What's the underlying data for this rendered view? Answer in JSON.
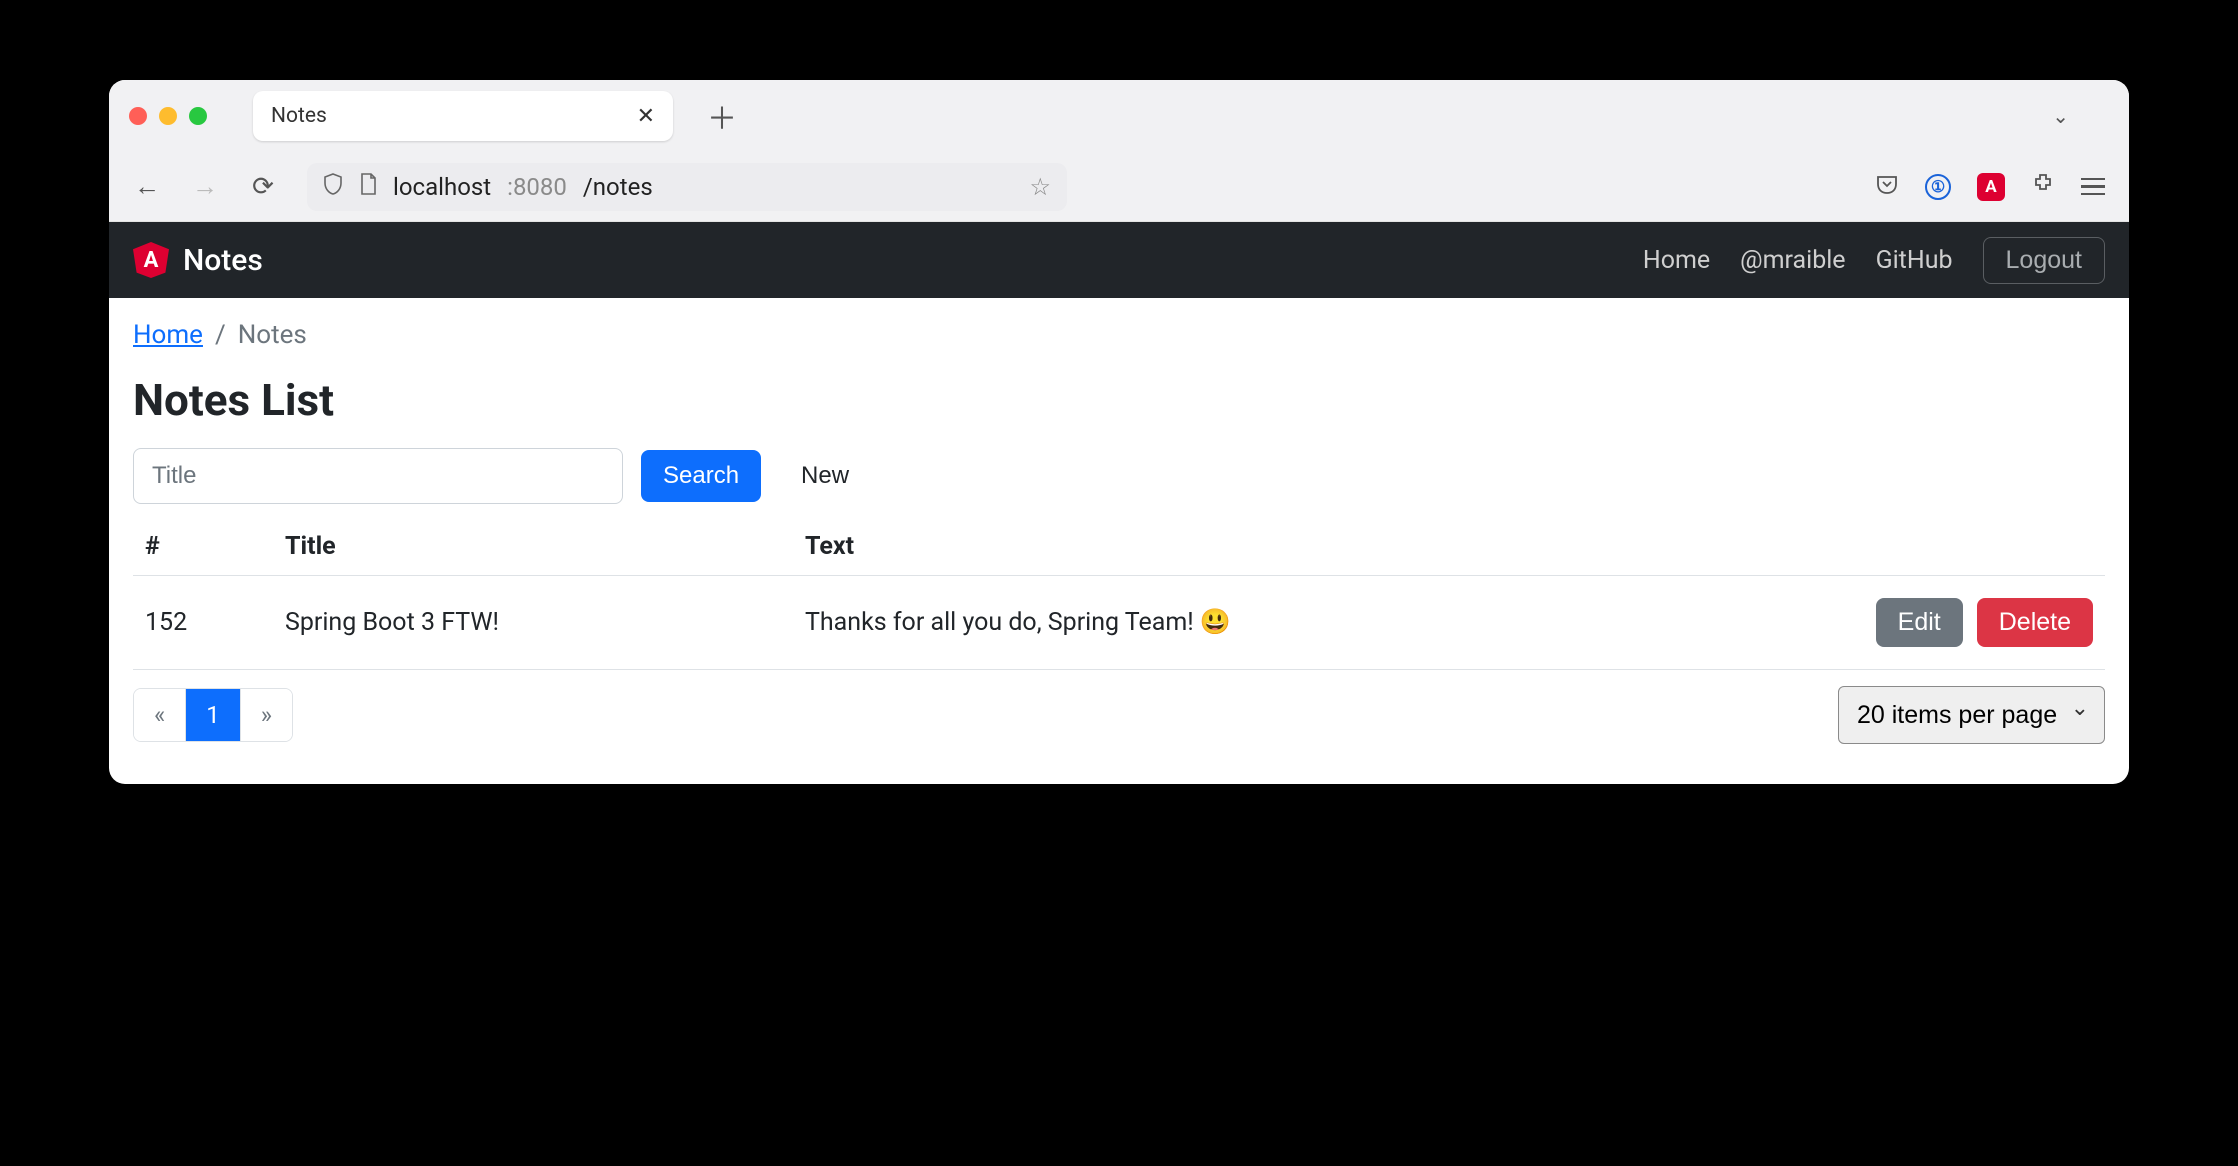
{
  "browser": {
    "tab_title": "Notes",
    "url_host": "localhost",
    "url_port": ":8080",
    "url_path": "/notes"
  },
  "nav": {
    "brand": "Notes",
    "links": {
      "home": "Home",
      "user": "@mraible",
      "github": "GitHub"
    },
    "logout": "Logout"
  },
  "breadcrumb": {
    "home": "Home",
    "sep": "/",
    "current": "Notes"
  },
  "page": {
    "title": "Notes List",
    "search_placeholder": "Title",
    "search_btn": "Search",
    "new_link": "New"
  },
  "table": {
    "headers": {
      "id": "#",
      "title": "Title",
      "text": "Text"
    },
    "rows": [
      {
        "id": "152",
        "title": "Spring Boot 3 FTW!",
        "text": "Thanks for all you do, Spring Team! 😃"
      }
    ],
    "actions": {
      "edit": "Edit",
      "delete": "Delete"
    }
  },
  "pagination": {
    "prev": "«",
    "pages": [
      "1"
    ],
    "next": "»",
    "page_size_selected": "20 items per page"
  }
}
